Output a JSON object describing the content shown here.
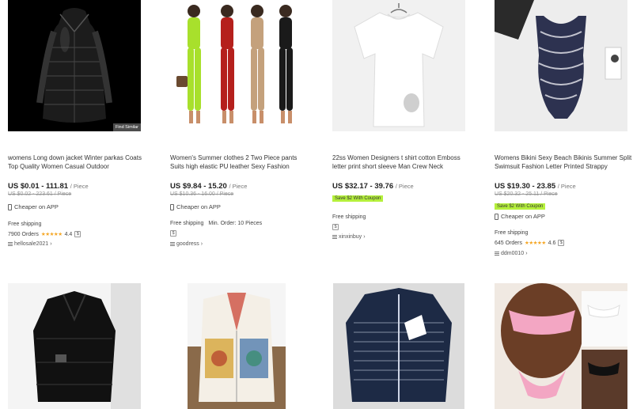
{
  "products": [
    {
      "title": "womens Long down jacket Winter parkas Coats Top Quality Women Casual Outdoor",
      "price": "US $0.01 - 111.81",
      "unit": "/ Piece",
      "old_price": "US $0.02 - 223.61 / Piece",
      "coupon": "",
      "cheaper_on_app": "Cheaper on APP",
      "shipping": "Free shipping",
      "min_order": "",
      "orders": "7900 Orders",
      "rating": "4.4",
      "store": "hellosale2021",
      "find_similar": "Find Similar"
    },
    {
      "title": "Women's Summer clothes 2 Two Piece pants Suits high elastic PU leather Sexy Fashion",
      "price": "US $9.84 - 15.20",
      "unit": "/ Piece",
      "old_price": "US $10.36 - 16.00 / Piece",
      "coupon": "",
      "cheaper_on_app": "Cheaper on APP",
      "shipping": "Free shipping",
      "min_order": "Min. Order: 10 Pieces",
      "orders": "",
      "rating": "",
      "store": "goodress"
    },
    {
      "title": "22ss Women Designers t shirt cotton Emboss letter print short sleeve Man Crew Neck",
      "price": "US $32.17 - 39.76",
      "unit": "/ Piece",
      "old_price": "",
      "coupon": "Save $2 With Coupon",
      "cheaper_on_app": "",
      "shipping": "Free shipping",
      "min_order": "",
      "orders": "",
      "rating": "",
      "store": "xinxinbuy"
    },
    {
      "title": "Womens Bikini Sexy Beach Bikinis Summer Split Swimsuit Fashion Letter Printed Strappy",
      "price": "US $19.30 - 23.85",
      "unit": "/ Piece",
      "old_price": "US $20.32 - 25.11 / Piece",
      "coupon": "Save $2 With Coupon",
      "cheaper_on_app": "Cheaper on APP",
      "shipping": "Free shipping",
      "min_order": "",
      "orders": "645 Orders",
      "rating": "4.6",
      "store": "ddm0010"
    }
  ],
  "bottom_products": [
    {
      "image": "black-puffer-jacket"
    },
    {
      "image": "patterned-cardigan"
    },
    {
      "image": "navy-knit-cardigan"
    },
    {
      "image": "pink-bikini"
    }
  ],
  "colors": {
    "coupon_bg": "#b5f03c",
    "star": "#f5a623"
  }
}
